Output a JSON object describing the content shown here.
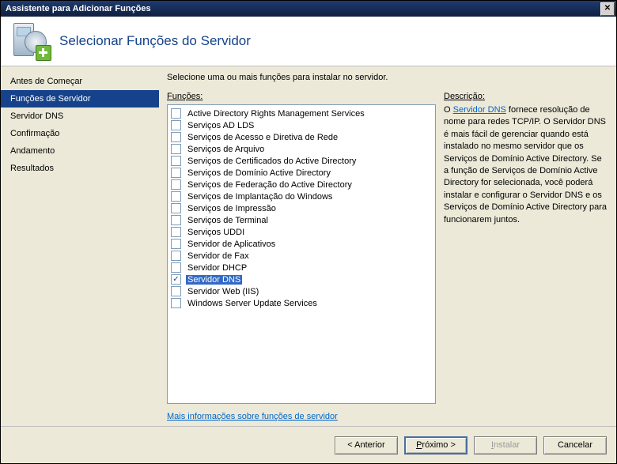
{
  "window": {
    "title": "Assistente para Adicionar Funções"
  },
  "header": {
    "title": "Selecionar Funções do Servidor"
  },
  "sidebar": {
    "items": [
      {
        "label": "Antes de Começar",
        "selected": false
      },
      {
        "label": "Funções de Servidor",
        "selected": true
      },
      {
        "label": "Servidor DNS",
        "selected": false
      },
      {
        "label": "Confirmação",
        "selected": false
      },
      {
        "label": "Andamento",
        "selected": false
      },
      {
        "label": "Resultados",
        "selected": false
      }
    ]
  },
  "content": {
    "instruction": "Selecione uma ou mais funções para instalar no servidor.",
    "roles_label_u": "F",
    "roles_label_rest": "unções:",
    "description_label": "Descrição:",
    "more_info": "Mais informações sobre funções de servidor",
    "description_link": "Servidor DNS",
    "description_text": " fornece resolução de nome para redes TCP/IP. O Servidor DNS é mais fácil de gerenciar quando está instalado no mesmo servidor que os Serviços de Domínio Active Directory. Se a função de Serviços de Domínio Active Directory for selecionada, você poderá instalar e configurar o Servidor DNS e os Serviços de Domínio Active Directory para funcionarem juntos.",
    "roles": [
      {
        "label": "Active Directory Rights Management Services",
        "checked": false,
        "selected": false
      },
      {
        "label": "Serviços AD LDS",
        "checked": false,
        "selected": false
      },
      {
        "label": "Serviços de Acesso e Diretiva de Rede",
        "checked": false,
        "selected": false
      },
      {
        "label": "Serviços de Arquivo",
        "checked": false,
        "selected": false
      },
      {
        "label": "Serviços de Certificados do Active Directory",
        "checked": false,
        "selected": false
      },
      {
        "label": "Serviços de Domínio Active Directory",
        "checked": false,
        "selected": false
      },
      {
        "label": "Serviços de Federação do Active Directory",
        "checked": false,
        "selected": false
      },
      {
        "label": "Serviços de Implantação do Windows",
        "checked": false,
        "selected": false
      },
      {
        "label": "Serviços de Impressão",
        "checked": false,
        "selected": false
      },
      {
        "label": "Serviços de Terminal",
        "checked": false,
        "selected": false
      },
      {
        "label": "Serviços UDDI",
        "checked": false,
        "selected": false
      },
      {
        "label": "Servidor de Aplicativos",
        "checked": false,
        "selected": false
      },
      {
        "label": "Servidor de Fax",
        "checked": false,
        "selected": false
      },
      {
        "label": "Servidor DHCP",
        "checked": false,
        "selected": false
      },
      {
        "label": "Servidor DNS",
        "checked": true,
        "selected": true
      },
      {
        "label": "Servidor Web (IIS)",
        "checked": false,
        "selected": false
      },
      {
        "label": "Windows Server Update Services",
        "checked": false,
        "selected": false
      }
    ]
  },
  "buttons": {
    "back": "Anterior",
    "next_u": "P",
    "next_rest": "róximo",
    "install_u": "I",
    "install_rest": "nstalar",
    "cancel": "Cancelar"
  }
}
